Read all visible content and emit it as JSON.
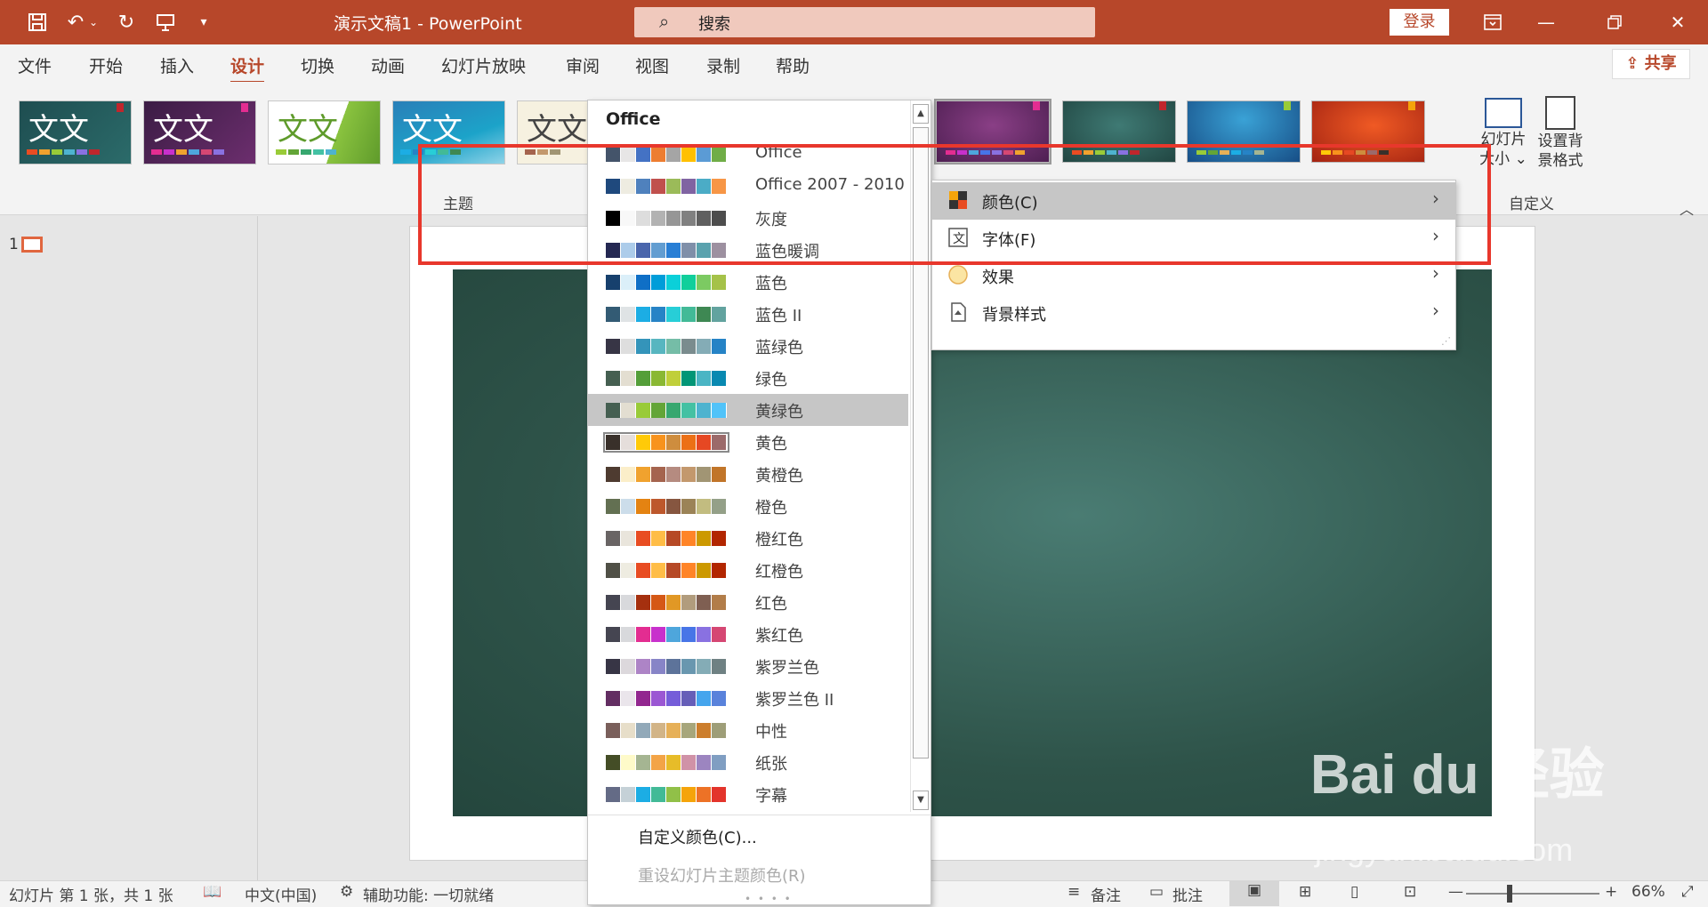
{
  "app": {
    "title": "演示文稿1 - PowerPoint",
    "search_label": "搜索",
    "login_label": "登录"
  },
  "menu": {
    "tabs": [
      "文件",
      "开始",
      "插入",
      "设计",
      "切换",
      "动画",
      "幻灯片放映",
      "审阅",
      "视图",
      "录制",
      "帮助"
    ],
    "active": "设计",
    "share_label": "共享"
  },
  "ribbon": {
    "themes_group_label": "主题",
    "theme_glyph": "文文",
    "slide_size_label": [
      "幻灯片",
      "大小 ⌄"
    ],
    "bg_format_label": [
      "设置背",
      "景格式"
    ],
    "custom_group_label": "自定义"
  },
  "colors_panel": {
    "header": "Office",
    "schemes": [
      {
        "name": "Office",
        "colors": [
          "#44546a",
          "#e7e6e6",
          "#4472c4",
          "#ed7d31",
          "#a5a5a5",
          "#ffc000",
          "#5b9bd5",
          "#70ad47"
        ]
      },
      {
        "name": "Office 2007 - 2010",
        "colors": [
          "#1f497d",
          "#eeece1",
          "#4f81bd",
          "#c0504d",
          "#9bbb59",
          "#8064a2",
          "#4bacc6",
          "#f79646"
        ]
      },
      {
        "name": "灰度",
        "colors": [
          "#000000",
          "#f8f8f8",
          "#dddddd",
          "#b2b2b2",
          "#969696",
          "#808080",
          "#5f5f5f",
          "#4d4d4d"
        ]
      },
      {
        "name": "蓝色暖调",
        "colors": [
          "#242852",
          "#acccea",
          "#4a66ac",
          "#629dd1",
          "#297fd5",
          "#7f8fa9",
          "#5aa2ae",
          "#9d90a0"
        ]
      },
      {
        "name": "蓝色",
        "colors": [
          "#17406d",
          "#dbeff9",
          "#0f6fc6",
          "#009dd9",
          "#0bd0d9",
          "#10cf9b",
          "#7cca62",
          "#a5c249"
        ]
      },
      {
        "name": "蓝色 II",
        "colors": [
          "#335b74",
          "#dfe3e5",
          "#1cade4",
          "#2683c6",
          "#27ced7",
          "#42ba97",
          "#3e8853",
          "#62a39f"
        ]
      },
      {
        "name": "蓝绿色",
        "colors": [
          "#373545",
          "#dedede",
          "#3494ba",
          "#58b6c0",
          "#75bda7",
          "#7a8c8e",
          "#84acb6",
          "#2683c6"
        ]
      },
      {
        "name": "绿色",
        "colors": [
          "#455f51",
          "#e3ded1",
          "#549e39",
          "#8ab833",
          "#c0cf3a",
          "#029676",
          "#4ab5c4",
          "#0989b1"
        ]
      },
      {
        "name": "黄绿色",
        "colors": [
          "#455f51",
          "#e3ded1",
          "#99cb38",
          "#63a537",
          "#37a76f",
          "#44c1a3",
          "#4eb3cf",
          "#51c3f9"
        ]
      },
      {
        "name": "黄色",
        "colors": [
          "#39302a",
          "#e5dedb",
          "#ffca08",
          "#f8931d",
          "#ce8d3e",
          "#ec7016",
          "#e64823",
          "#9c6a6a"
        ]
      },
      {
        "name": "黄橙色",
        "colors": [
          "#4e3b30",
          "#fbeec9",
          "#f0a22e",
          "#a5644e",
          "#b58b80",
          "#c3986d",
          "#a19574",
          "#c17529"
        ]
      },
      {
        "name": "橙色",
        "colors": [
          "#637052",
          "#ccddea",
          "#e48312",
          "#bd582c",
          "#865640",
          "#9b8357",
          "#c2bc80",
          "#94a088"
        ]
      },
      {
        "name": "橙红色",
        "colors": [
          "#696464",
          "#e9e5dc",
          "#e84c22",
          "#ffbd47",
          "#b64926",
          "#ff8427",
          "#cc9900",
          "#b22600"
        ]
      },
      {
        "name": "红橙色",
        "colors": [
          "#505046",
          "#eeece1",
          "#e84c22",
          "#ffbd47",
          "#b64926",
          "#ff8427",
          "#cc9900",
          "#b22600"
        ]
      },
      {
        "name": "红色",
        "colors": [
          "#454551",
          "#d8d9dc",
          "#a5300f",
          "#d55816",
          "#e19825",
          "#b19c7d",
          "#7f5f52",
          "#b27d49"
        ]
      },
      {
        "name": "紫红色",
        "colors": [
          "#454551",
          "#d8d9dc",
          "#e32d91",
          "#c830cc",
          "#4ea6dc",
          "#4775e7",
          "#8971e1",
          "#d54773"
        ]
      },
      {
        "name": "紫罗兰色",
        "colors": [
          "#373545",
          "#dcd8dc",
          "#ad84c6",
          "#8784c7",
          "#5d739a",
          "#6997af",
          "#84acb6",
          "#6f8183"
        ]
      },
      {
        "name": "紫罗兰色 II",
        "colors": [
          "#632e62",
          "#eae5eb",
          "#92278f",
          "#9b57d3",
          "#755dd9",
          "#665eb8",
          "#45a5ed",
          "#5982db"
        ]
      },
      {
        "name": "中性",
        "colors": [
          "#7a5f5b",
          "#e7dec9",
          "#92a9b9",
          "#d2b487",
          "#e6b058",
          "#a7a67b",
          "#cc7e2d",
          "#9e9e78"
        ]
      },
      {
        "name": "纸张",
        "colors": [
          "#444d26",
          "#fefac9",
          "#a5b592",
          "#f3a447",
          "#e7bc29",
          "#d092a7",
          "#9c85c0",
          "#809ec2"
        ]
      },
      {
        "name": "字幕",
        "colors": [
          "#646b86",
          "#c5d1d7",
          "#1cade4",
          "#42ba97",
          "#91c048",
          "#f5a40a",
          "#ed7226",
          "#e3342b"
        ]
      }
    ],
    "hovered": "黄绿色",
    "selected": "黄色",
    "custom_colors": "自定义颜色(C)...",
    "reset_colors": "重设幻灯片主题颜色(R)"
  },
  "variants_menu": {
    "items": [
      {
        "label": "颜色(C)",
        "icon": "color-swatch-icon"
      },
      {
        "label": "字体(F)",
        "icon": "font-icon"
      },
      {
        "label": "效果",
        "icon": "effects-icon"
      },
      {
        "label": "背景样式",
        "icon": "background-style-icon"
      }
    ],
    "hovered": "颜色(C)"
  },
  "slide_pane": {
    "slide_number": "1"
  },
  "status": {
    "slide_info": "幻灯片 第 1 张，共 1 张",
    "language": "中文(中国)",
    "accessibility": "辅助功能: 一切就绪",
    "notes": "备注",
    "comments": "批注",
    "zoom": "66%"
  },
  "watermark": {
    "logo": "Bai du 经验",
    "url": "jingyan.baidu.com"
  },
  "colors": {
    "accent": "#b7472a",
    "highlight": "#e8372c"
  }
}
